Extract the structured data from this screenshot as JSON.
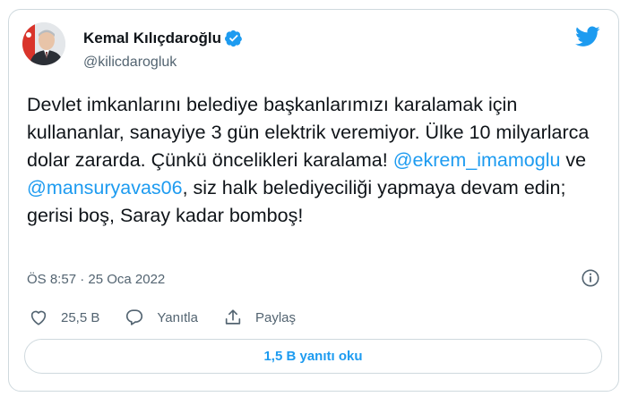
{
  "author": {
    "name": "Kemal Kılıçdaroğlu",
    "handle": "@kilicdarogluk"
  },
  "tweet": {
    "text_1": "Devlet imkanlarını belediye başkanlarımızı karalamak için kullananlar, sanayiye 3 gün elektrik veremiyor. Ülke 10 milyarlarca dolar zararda. Çünkü öncelikleri karalama! ",
    "mention_1": "@ekrem_imamoglu",
    "text_2": " ve ",
    "mention_2": "@mansuryavas06",
    "text_3": ", siz halk belediyeciliği yapmaya devam edin; gerisi boş, Saray kadar bomboş!"
  },
  "meta": {
    "timestamp": "ÖS 8:57 · 25 Oca 2022"
  },
  "actions": {
    "like_count": "25,5 B",
    "reply_label": "Yanıtla",
    "share_label": "Paylaş"
  },
  "read_replies_label": "1,5 B yanıtı oku",
  "colors": {
    "accent": "#1d9bf0",
    "text": "#0f1419",
    "secondary": "#536471",
    "border": "#cfd9de"
  },
  "icons": [
    "verified-badge-icon",
    "twitter-bird-icon",
    "info-icon",
    "heart-icon",
    "reply-bubble-icon",
    "share-icon"
  ]
}
